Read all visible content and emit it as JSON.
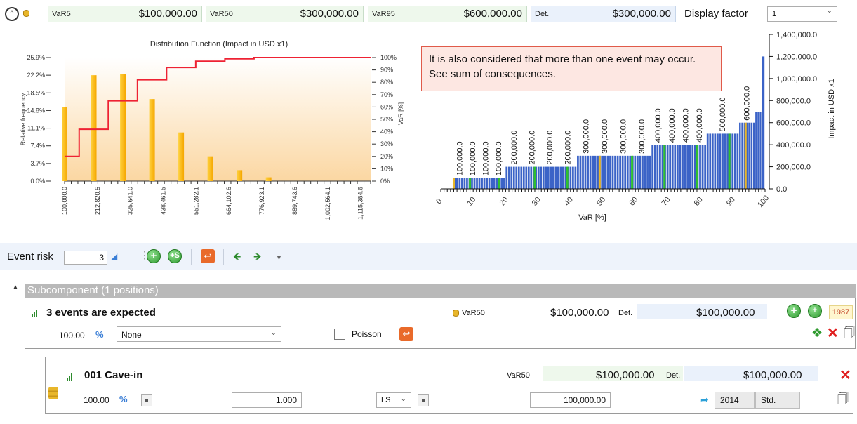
{
  "top": {
    "vars": [
      {
        "label": "VaR5",
        "value": "$100,000.00"
      },
      {
        "label": "VaR50",
        "value": "$300,000.00"
      },
      {
        "label": "VaR95",
        "value": "$600,000.00"
      },
      {
        "label": "Det.",
        "value": "$300,000.00"
      }
    ],
    "display_factor_label": "Display factor",
    "display_factor_value": "1"
  },
  "callout": "It is also considered that more than one event may occur. See sum of consequences.",
  "chart_data": [
    {
      "type": "bar",
      "title": "Distribution Function (Impact in USD x1)",
      "ylabel": "Relative frequency",
      "y2label": "VaR [%]",
      "yticks": [
        "25.9%",
        "22.2%",
        "18.5%",
        "14.8%",
        "11.1%",
        "7.4%",
        "3.7%",
        "0.0%"
      ],
      "y2ticks": [
        "100%",
        "90%",
        "80%",
        "70%",
        "60%",
        "50%",
        "40%",
        "30%",
        "20%",
        "10%",
        "0%"
      ],
      "xticks": [
        "100,000.0",
        "212,820.5",
        "325,641.0",
        "438,461.5",
        "551,282.1",
        "664,102.6",
        "776,923.1",
        "889,743.6",
        "1,002,564.1",
        "1,115,384.6"
      ],
      "ylim": [
        0,
        25.9
      ],
      "bars": [
        {
          "x": 100000,
          "y": 15.5
        },
        {
          "x": 200000,
          "y": 22.2
        },
        {
          "x": 300000,
          "y": 22.4
        },
        {
          "x": 400000,
          "y": 17.2
        },
        {
          "x": 500000,
          "y": 10.2
        },
        {
          "x": 600000,
          "y": 5.2
        },
        {
          "x": 700000,
          "y": 2.3
        },
        {
          "x": 800000,
          "y": 0.8
        }
      ],
      "cdf_line": {
        "x": [
          100000,
          150000,
          150000,
          250000,
          250000,
          350000,
          350000,
          450000,
          450000,
          550000,
          550000,
          650000,
          650000,
          750000,
          750000,
          850000,
          850000,
          1150000
        ],
        "y": [
          20,
          20,
          42,
          42,
          65,
          65,
          82,
          82,
          92,
          92,
          97,
          97,
          99,
          99,
          100,
          100,
          100,
          100
        ]
      }
    },
    {
      "type": "bar",
      "xlabel": "VaR [%]",
      "ylabel": "Impact in USD x1",
      "xticks": [
        "0",
        "10",
        "20",
        "30",
        "40",
        "50",
        "60",
        "70",
        "80",
        "90",
        "100"
      ],
      "yticks": [
        "1,400,000.0",
        "1,200,000.0",
        "1,000,000.0",
        "800,000.0",
        "600,000.0",
        "400,000.0",
        "200,000.0",
        "0.0"
      ],
      "ylim": [
        0,
        1400000
      ],
      "steps": [
        {
          "from": 4,
          "to": 20,
          "value": 100000,
          "labels": [
            "100,000.0",
            "100,000.0",
            "100,000.0",
            "100,000.0"
          ]
        },
        {
          "from": 20,
          "to": 42,
          "value": 200000,
          "labels": [
            "200,000.0",
            "200,000.0",
            "200,000.0",
            "200,000.0"
          ]
        },
        {
          "from": 42,
          "to": 65,
          "value": 300000,
          "labels": [
            "300,000.0",
            "300,000.0",
            "300,000.0",
            "300,000.0"
          ]
        },
        {
          "from": 65,
          "to": 82,
          "value": 400000,
          "labels": [
            "400,000.0",
            "400,000.0",
            "400,000.0",
            "400,000.0"
          ]
        },
        {
          "from": 82,
          "to": 92,
          "value": 500000,
          "labels": [
            "500,000.0"
          ]
        },
        {
          "from": 92,
          "to": 97,
          "value": 600000,
          "labels": [
            "600,000.0"
          ]
        },
        {
          "from": 97,
          "to": 99,
          "value": 700000,
          "labels": []
        },
        {
          "from": 99,
          "to": 100,
          "value": 1200000,
          "labels": []
        }
      ],
      "markers": [
        {
          "pct": 4,
          "color": "#e8b62a"
        },
        {
          "pct": 9,
          "color": "#2fbf2f"
        },
        {
          "pct": 18,
          "color": "#2fbf2f"
        },
        {
          "pct": 29,
          "color": "#2fbf2f"
        },
        {
          "pct": 39,
          "color": "#2fbf2f"
        },
        {
          "pct": 49,
          "color": "#e8b62a"
        },
        {
          "pct": 59,
          "color": "#2fbf2f"
        },
        {
          "pct": 69,
          "color": "#2fbf2f"
        },
        {
          "pct": 79,
          "color": "#2fbf2f"
        },
        {
          "pct": 89,
          "color": "#2fbf2f"
        },
        {
          "pct": 94,
          "color": "#e8b62a"
        }
      ]
    }
  ],
  "toolbar": {
    "event_risk_label": "Event risk",
    "event_risk_value": "3"
  },
  "subcomponent": {
    "header": "Subcomponent (1 positions)",
    "title": "3 events are expected",
    "var_label": "VaR50",
    "var_value": "$100,000.00",
    "det_label": "Det.",
    "det_value": "$100,000.00",
    "badge": "1987",
    "percent": "100.00",
    "distribution": "None",
    "poisson_label": "Poisson"
  },
  "item": {
    "title": "001  Cave-in",
    "var_label": "VaR50",
    "var_value": "$100,000.00",
    "det_label": "Det.",
    "det_value": "$100,000.00",
    "percent": "100.00",
    "quantity": "1.000",
    "unit": "LS",
    "price": "100,000.00",
    "year": "2014",
    "std": "Std."
  }
}
